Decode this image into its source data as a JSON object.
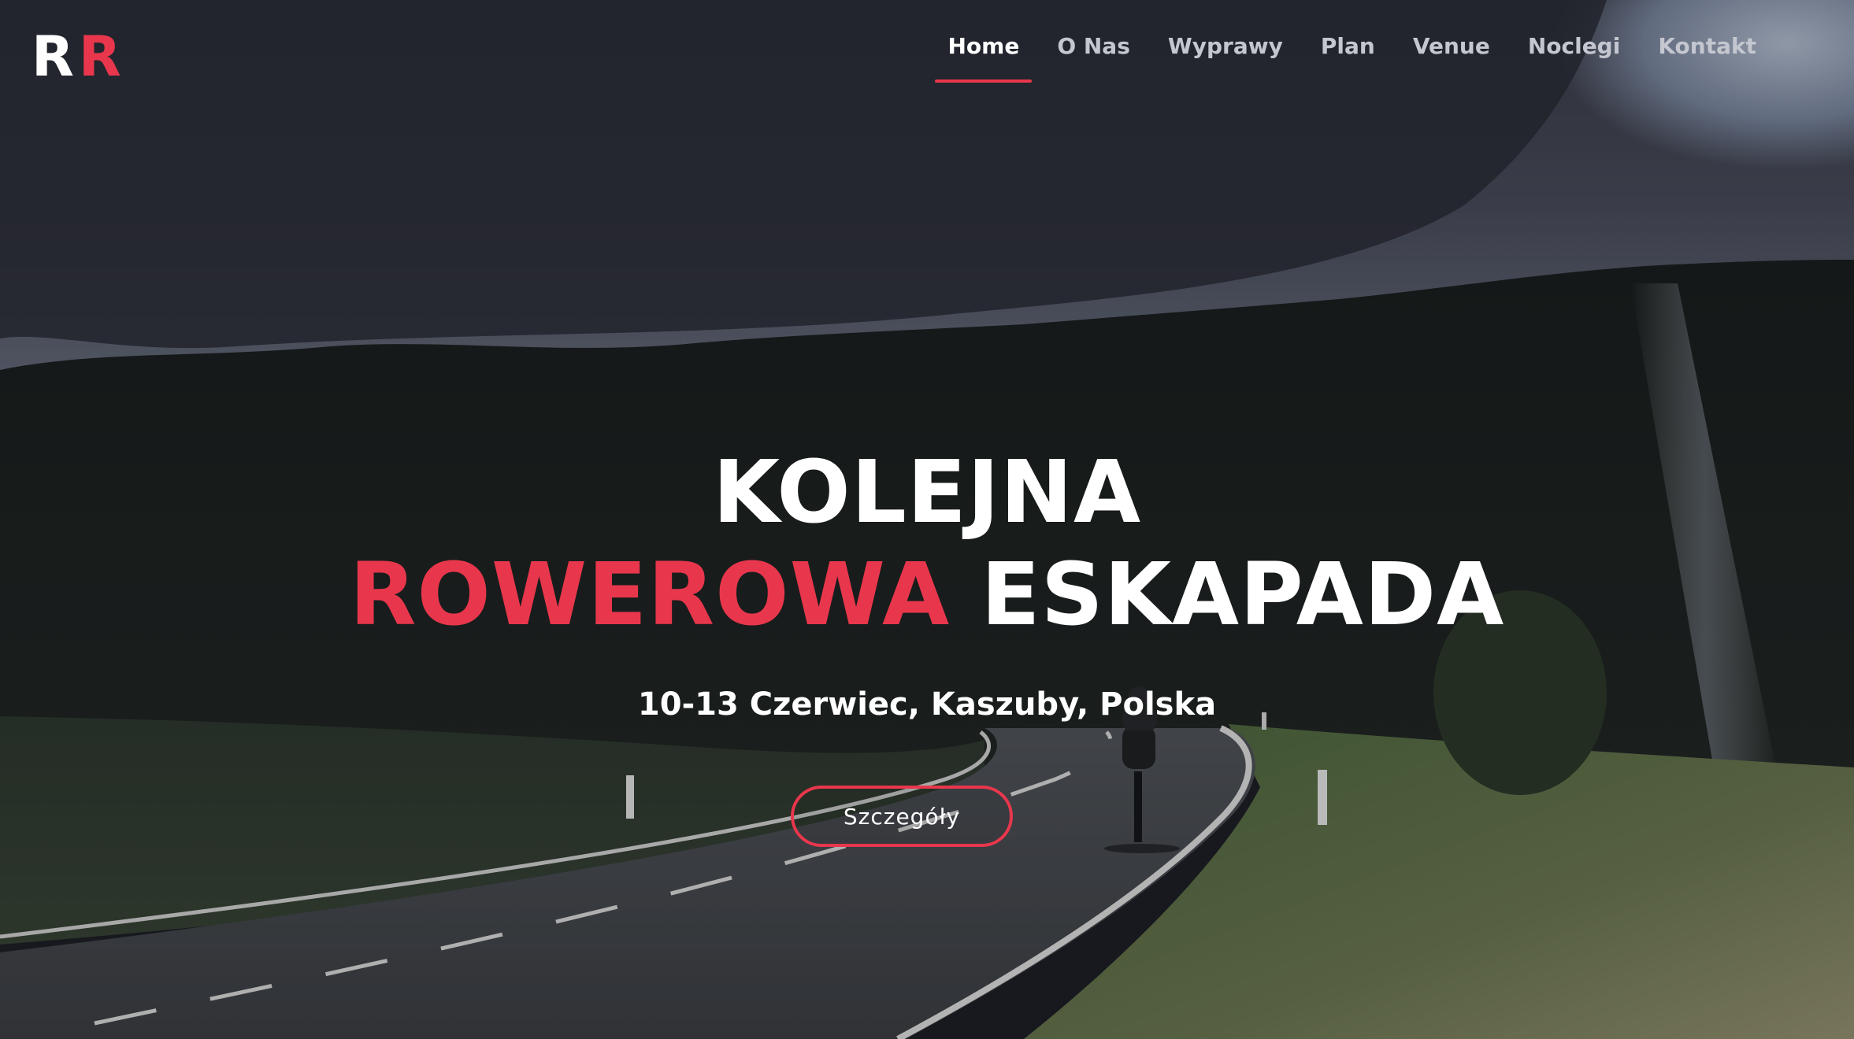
{
  "logo": {
    "letter_1": "R",
    "letter_2": "R"
  },
  "nav": {
    "items": [
      {
        "label": "Home",
        "active": true
      },
      {
        "label": "O Nas",
        "active": false
      },
      {
        "label": "Wyprawy",
        "active": false
      },
      {
        "label": "Plan",
        "active": false
      },
      {
        "label": "Venue",
        "active": false
      },
      {
        "label": "Noclegi",
        "active": false
      },
      {
        "label": "Kontakt",
        "active": false
      }
    ]
  },
  "hero": {
    "headline_line1": "KOLEJNA",
    "headline_accent": "ROWEROWA",
    "headline_rest": "ESKAPADA",
    "subtitle": "10-13 Czerwiec, Kaszuby, Polska",
    "cta_label": "Szczegóły",
    "background_icon": "road-cyclist-landscape-photo"
  },
  "colors": {
    "accent": "#e8374c",
    "text": "#ffffff",
    "nav_inactive": "#c4c7cf"
  }
}
